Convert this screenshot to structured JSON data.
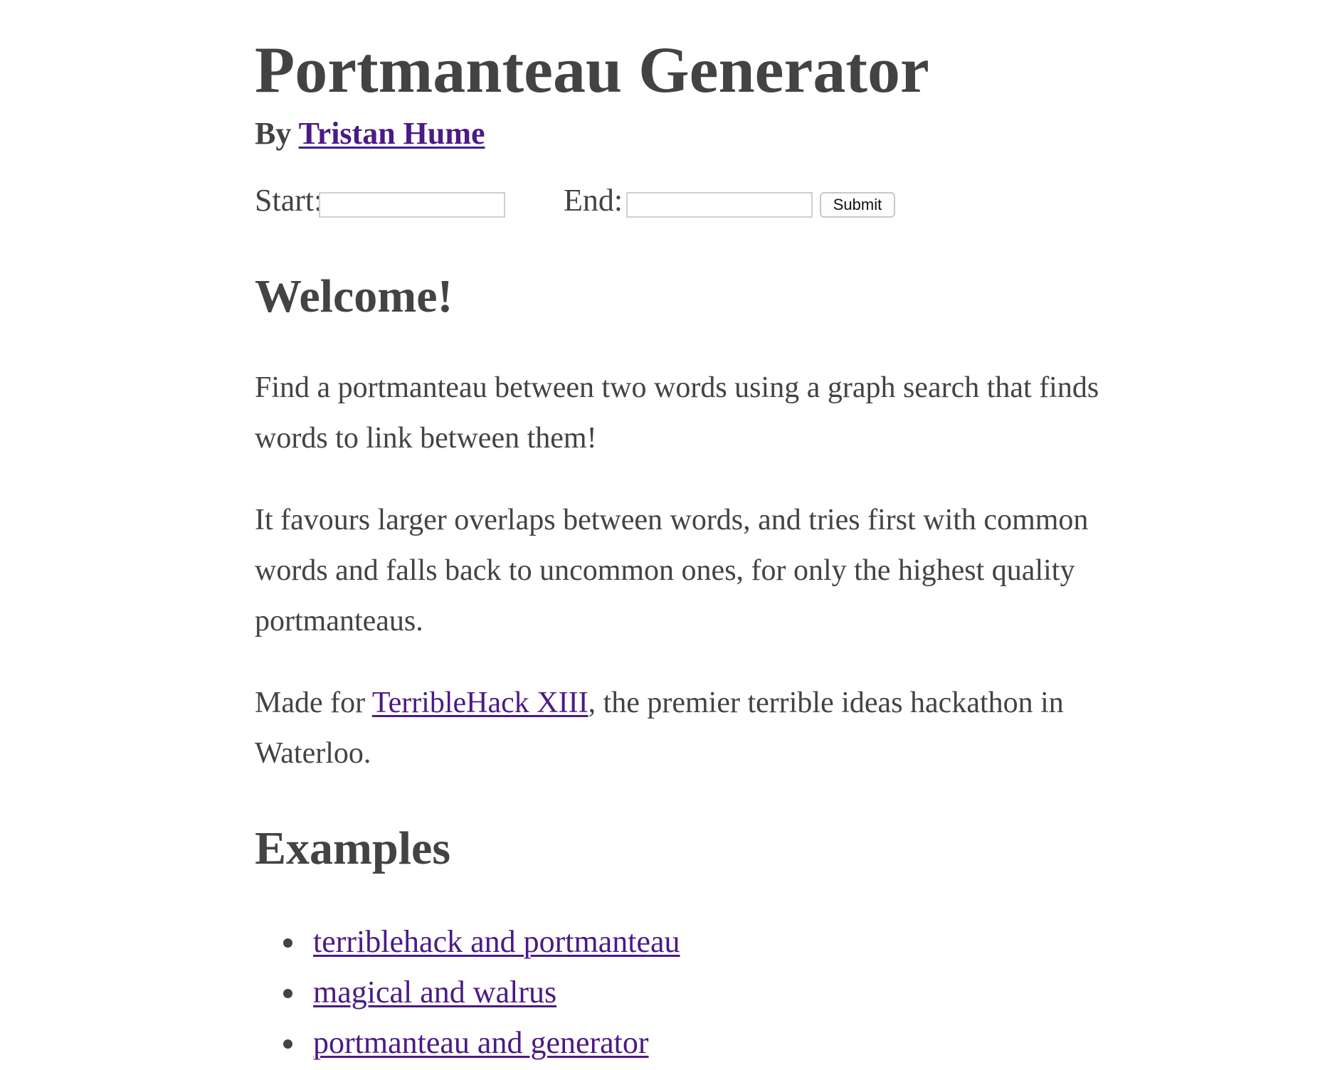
{
  "header": {
    "title": "Portmanteau Generator",
    "by_prefix": "By",
    "author_link": "Tristan Hume"
  },
  "form": {
    "start_label": "Start:",
    "start_value": "",
    "end_label": "End:",
    "end_value": "",
    "submit_label": "Submit"
  },
  "welcome": {
    "heading": "Welcome!",
    "para1": "Find a portmanteau between two words using a graph search that finds words to link between them!",
    "para2": "It favours larger overlaps between words, and tries first with common words and falls back to uncommon ones, for only the highest quality portmanteaus.",
    "para3_before": "Made for ",
    "para3_link": "TerribleHack XIII",
    "para3_after": ", the premier terrible ideas hackathon in Waterloo."
  },
  "examples": {
    "heading": "Examples",
    "items": [
      "terriblehack and portmanteau",
      "magical and walrus",
      "portmanteau and generator"
    ]
  },
  "colors": {
    "text": "#434343",
    "link": "#4b1a86",
    "background": "#ffffff"
  }
}
